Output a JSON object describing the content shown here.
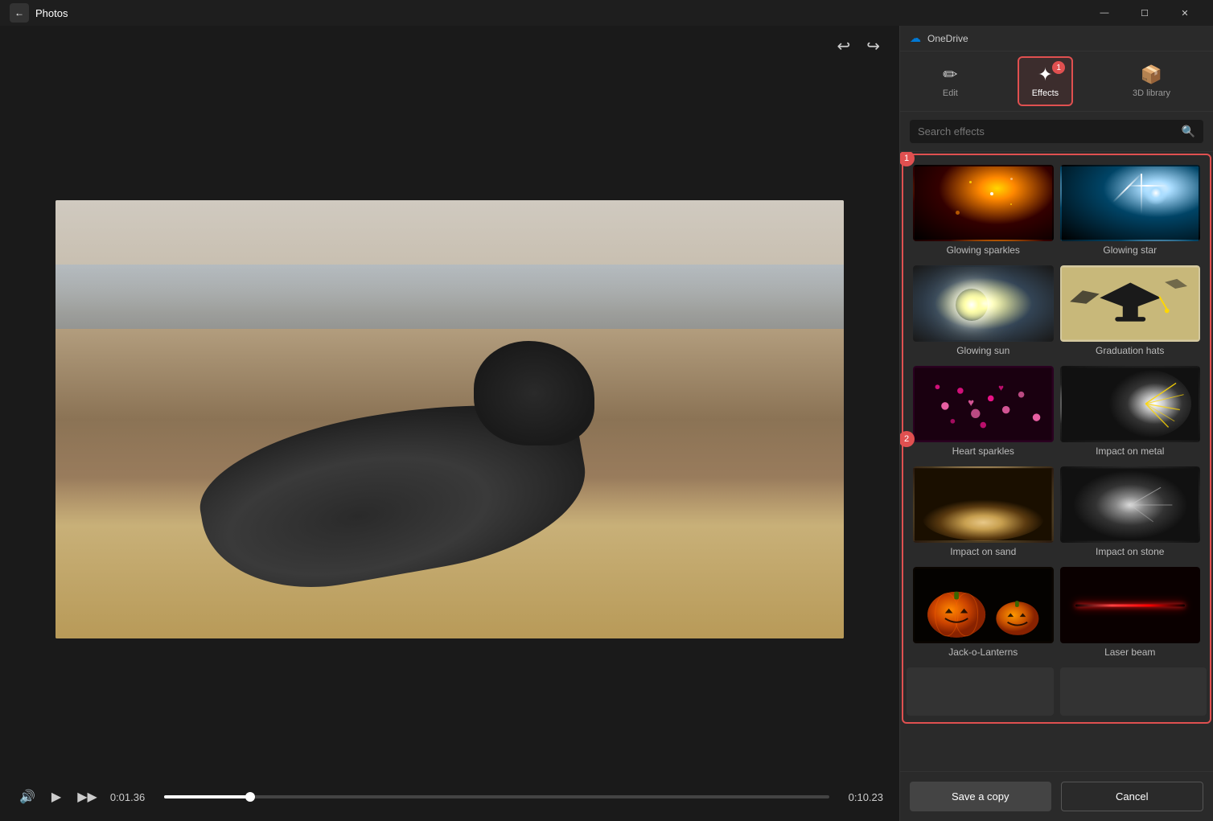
{
  "titlebar": {
    "back_label": "←",
    "title": "Photos",
    "minimize": "—",
    "maximize": "☐",
    "close": "✕"
  },
  "toolbar": {
    "undo": "↩",
    "redo": "↪"
  },
  "video": {
    "time_current": "0:01.36",
    "time_total": "0:10.23",
    "progress_percent": 13
  },
  "onedrive": {
    "title": "OneDrive"
  },
  "tabs": [
    {
      "id": "edit",
      "label": "Edit",
      "icon": "✏",
      "active": false,
      "badge": null
    },
    {
      "id": "effects",
      "label": "Effects",
      "icon": "✦",
      "active": true,
      "badge": "1"
    },
    {
      "id": "3dlibrary",
      "label": "3D library",
      "icon": "🎲",
      "active": false,
      "badge": null
    }
  ],
  "search": {
    "placeholder": "Search effects",
    "value": ""
  },
  "effects": [
    {
      "id": "glowing-sparkles",
      "label": "Glowing sparkles",
      "thumb_type": "sparkles"
    },
    {
      "id": "glowing-star",
      "label": "Glowing star",
      "thumb_type": "star"
    },
    {
      "id": "glowing-sun",
      "label": "Glowing sun",
      "thumb_type": "sun"
    },
    {
      "id": "graduation-hats",
      "label": "Graduation hats",
      "thumb_type": "graduation"
    },
    {
      "id": "heart-sparkles",
      "label": "Heart sparkles",
      "thumb_type": "hearts"
    },
    {
      "id": "impact-metal",
      "label": "Impact on metal",
      "thumb_type": "impact-metal"
    },
    {
      "id": "impact-sand",
      "label": "Impact on sand",
      "thumb_type": "impact-sand"
    },
    {
      "id": "impact-stone",
      "label": "Impact on stone",
      "thumb_type": "impact-stone"
    },
    {
      "id": "jack-o-lanterns",
      "label": "Jack-o-Lanterns",
      "thumb_type": "jack"
    },
    {
      "id": "laser-beam",
      "label": "Laser beam",
      "thumb_type": "laser"
    }
  ],
  "section_badges": {
    "first": "1",
    "second": "2"
  },
  "footer": {
    "save_label": "Save a copy",
    "cancel_label": "Cancel"
  },
  "controls": {
    "volume": "🔊",
    "play": "▶",
    "skip": "▶▶"
  }
}
